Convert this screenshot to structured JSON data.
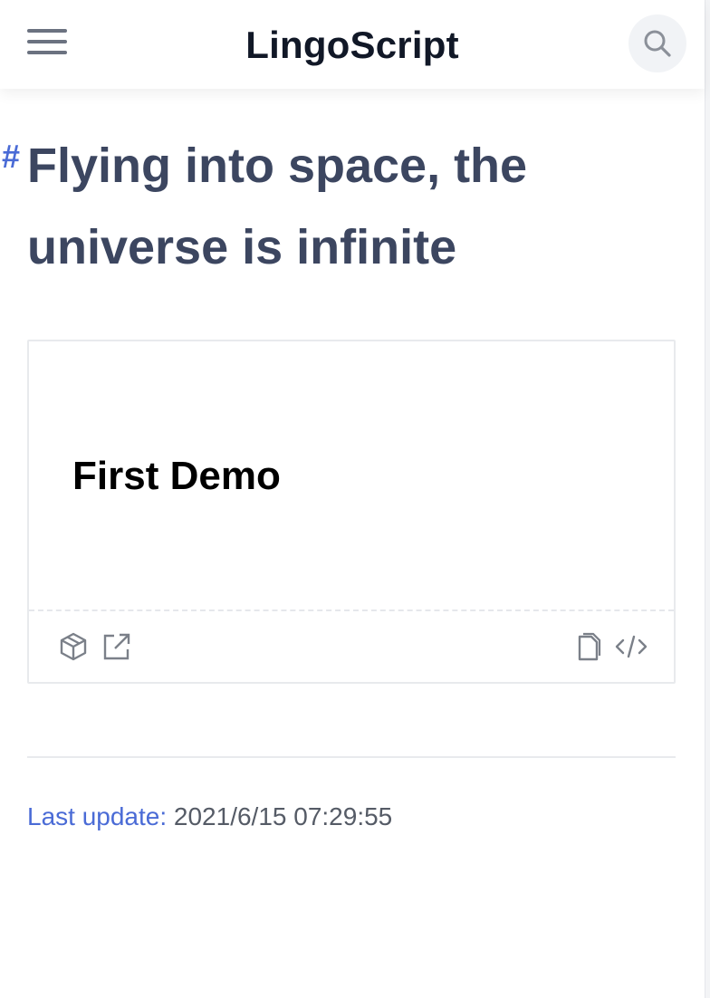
{
  "header": {
    "title": "LingoScript",
    "menu_icon": "hamburger-menu-icon",
    "search_icon": "search-icon"
  },
  "page": {
    "anchor": "#",
    "heading": "Flying into space, the universe is infinite"
  },
  "demo": {
    "title": "First Demo",
    "actions_left": [
      "codesandbox-icon",
      "open-external-icon"
    ],
    "actions_right": [
      "copy-icon",
      "code-icon"
    ]
  },
  "footer": {
    "last_update_label": "Last update:",
    "last_update_value": "2021/6/15 07:29:55"
  },
  "colors": {
    "accent": "#4a6bd6",
    "heading": "#3c4660",
    "title": "#111827"
  }
}
